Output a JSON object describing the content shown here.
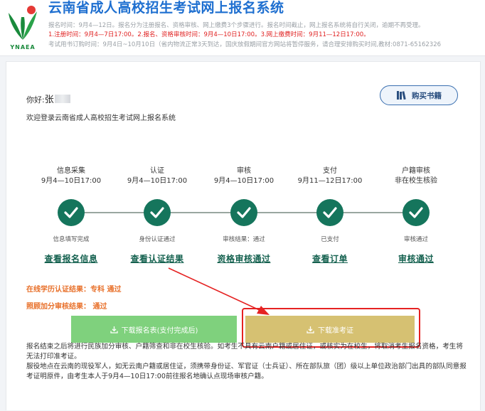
{
  "header": {
    "logo_text": "YNAEA",
    "title": "云南省成人高校招生考试网上报名系统",
    "notice_1": "报名时间：9月4—12日。报名分为注册报名、资格审核、网上缴费3个步骤进行。报名时间截止，网上报名系统将自行关闭，逾期不再受理。",
    "notice_2": "1.注册时间：9月4—7日17:00。2.报名、资格审核时间：9月4—10日17:00。3.网上缴费时间：9月11—12日17:00。",
    "notice_3": "考试用书订购时间：9月4日~10月10日（省内物流正常3天到达，国庆放假期间官方网站将暂停服务，请合理安排购买时间,教材:0871-65162326"
  },
  "user": {
    "greeting_prefix": "你好:",
    "name": "张",
    "welcome": "欢迎登录云南省成人高校招生考试网上报名系统"
  },
  "buy_books": {
    "label": "购买书籍"
  },
  "steps": [
    {
      "title": "信息采集",
      "date": "9月4—10日17:00",
      "status": "信息填写完成",
      "link": "查看报名信息"
    },
    {
      "title": "认证",
      "date": "9月4—10日17:00",
      "status": "身份认证通过",
      "link": "查看认证结果"
    },
    {
      "title": "审核",
      "date": "9月4—10日17:00",
      "status": "审核结果：通过",
      "link": "资格审核通过"
    },
    {
      "title": "支付",
      "date": "9月11—12日17:00",
      "status": "已支付",
      "link": "查看订单"
    },
    {
      "title": "户籍审核",
      "date": "非在校生核验",
      "status": "审核通过",
      "link": "审核通过"
    }
  ],
  "results": {
    "education": "在线学历认证结果：专科  通过",
    "bonus": "照顾加分审核结果：  通过"
  },
  "downloads": {
    "form_label": "下载报名表(支付完成后)",
    "ticket_label": "下载准考证"
  },
  "info": {
    "para_1": "报名结束之后将进行民族加分审核、户籍筛查和非在校生核验。如考生不具有云南户籍或居住证，或核实为在校生，将取消考生报名资格，考生将无法打印准考证。",
    "para_2": "服役地点在云南的现役军人，如无云南户籍或居住证，须携带身份证、军官证（士兵证）、所在部队旅（团）级以上单位政治部门出具的部队同意报考证明原件，由考生本人于9月4—10日17:00前往报名地确认点现场审核户籍。"
  },
  "colors": {
    "title_blue": "#1e6fd0",
    "step_green": "#15755c",
    "notice_red": "#e02020",
    "result_orange": "#e8702a",
    "btn_green": "#7fd17d",
    "btn_gold": "#d6c172",
    "highlight_red": "#e52222"
  }
}
